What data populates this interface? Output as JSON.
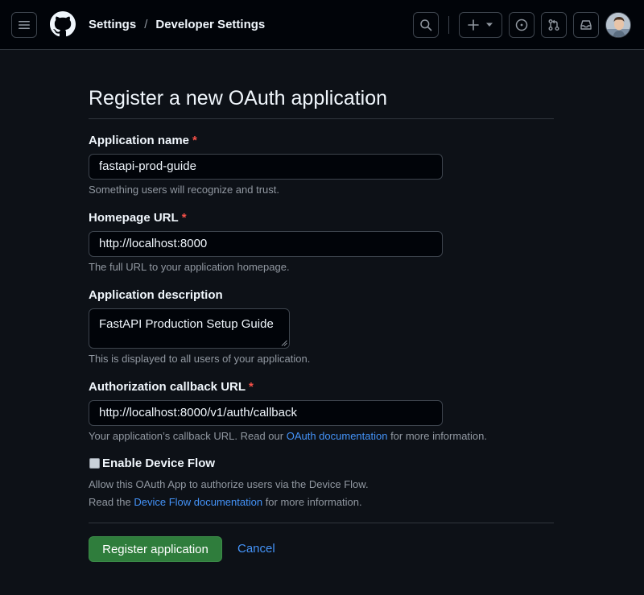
{
  "header": {
    "breadcrumbs": [
      "Settings",
      "Developer Settings"
    ],
    "separator": "/",
    "icons": {
      "menu": "hamburger-menu-icon",
      "logo": "github-logo-icon",
      "search": "search-icon",
      "create": "plus-icon",
      "create_caret": "caret-down-icon",
      "issues": "issue-opened-icon",
      "pull_requests": "git-pull-request-icon",
      "inbox": "inbox-icon"
    }
  },
  "page": {
    "title": "Register a new OAuth application"
  },
  "form": {
    "required_mark": "*",
    "app_name": {
      "label": "Application name",
      "value": "fastapi-prod-guide",
      "hint": "Something users will recognize and trust."
    },
    "homepage_url": {
      "label": "Homepage URL",
      "value": "http://localhost:8000",
      "hint": "The full URL to your application homepage."
    },
    "description": {
      "label": "Application description",
      "value": "FastAPI Production Setup Guide",
      "hint": "This is displayed to all users of your application."
    },
    "callback_url": {
      "label": "Authorization callback URL",
      "value": "http://localhost:8000/v1/auth/callback",
      "hint_prefix": "Your application’s callback URL. Read our ",
      "hint_link": "OAuth documentation",
      "hint_suffix": " for more information."
    },
    "device_flow": {
      "label": "Enable Device Flow",
      "checked": false,
      "hint_line1": "Allow this OAuth App to authorize users via the Device Flow.",
      "hint_line2_prefix": "Read the ",
      "hint_line2_link": "Device Flow documentation",
      "hint_line2_suffix": " for more information."
    },
    "submit_label": "Register application",
    "cancel_label": "Cancel"
  },
  "colors": {
    "background": "#0d1117",
    "header": "#010409",
    "primary_button": "#2f7d3c",
    "link": "#4493f8",
    "required": "#f85149"
  }
}
